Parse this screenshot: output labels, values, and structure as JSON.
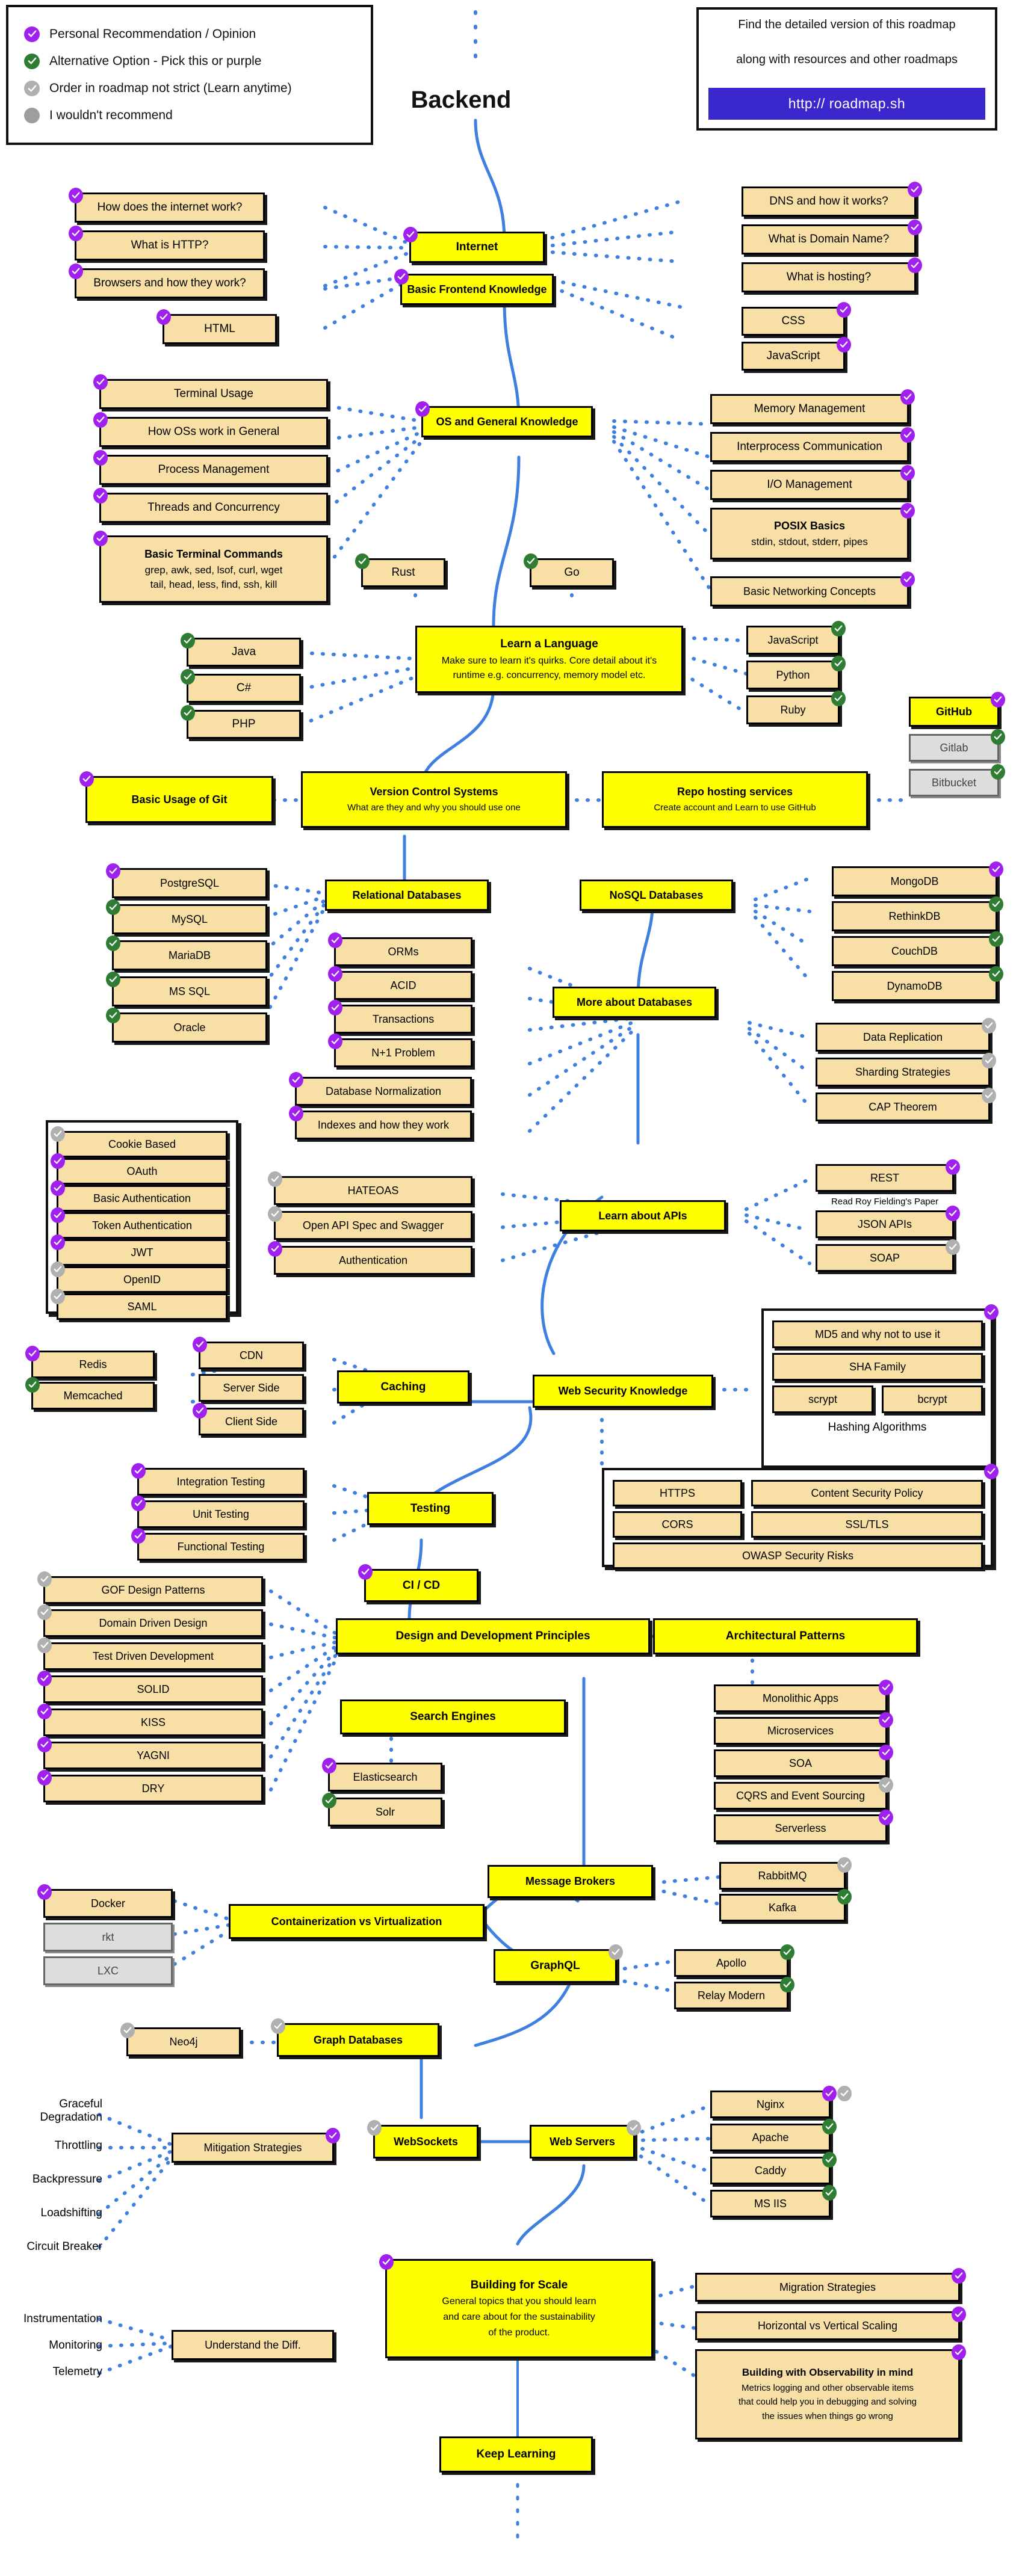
{
  "page_title": "Backend",
  "legend": {
    "items": [
      {
        "icon": "check-circle-icon",
        "color": "#A020F0",
        "label": "Personal Recommendation / Opinion"
      },
      {
        "icon": "check-circle-icon",
        "color": "#2E7D32",
        "label": "Alternative Option - Pick this or purple"
      },
      {
        "icon": "check-circle-icon",
        "color": "#B0B0B0",
        "label": "Order in roadmap not strict (Learn anytime)"
      },
      {
        "icon": "filled-circle-icon",
        "color": "#9E9E9E",
        "label": "I wouldn't recommend"
      }
    ]
  },
  "infobox": {
    "line1": "Find the detailed version of this roadmap",
    "line2": "along with resources and other roadmaps",
    "url_label": "http:// roadmap.sh",
    "url_bg": "#3B28CC"
  },
  "colors": {
    "primary_node": "#FFFF00",
    "sub_node": "#F7DFA5",
    "gray_node": "#DDDDDD",
    "link": "#3E7FE0",
    "purple": "#A020F0",
    "green": "#2E7D32",
    "gray_badge": "#B0B0B0"
  },
  "nodes": {
    "internet": "Internet",
    "basic_frontend": "Basic Frontend Knowledge",
    "how_internet": "How does the internet work?",
    "what_http": "What is HTTP?",
    "browsers": "Browsers and how they work?",
    "html": "HTML",
    "dns": "DNS and how it works?",
    "domain_name": "What is Domain Name?",
    "hosting": "What is hosting?",
    "css": "CSS",
    "javascript_front": "JavaScript",
    "os_general": "OS and General Knowledge",
    "terminal_usage": "Terminal Usage",
    "how_os_work": "How OSs work in General",
    "process_mgmt": "Process Management",
    "threads": "Threads and Concurrency",
    "basic_terminal_title": "Basic Terminal Commands",
    "basic_terminal_line1": "grep, awk, sed, lsof, curl, wget",
    "basic_terminal_line2": "tail, head, less, find, ssh, kill",
    "memory_mgmt": "Memory Management",
    "ipc": "Interprocess Communication",
    "io_mgmt": "I/O Management",
    "posix_title": "POSIX Basics",
    "posix_desc": "stdin, stdout, stderr, pipes",
    "basic_networking": "Basic Networking Concepts",
    "learn_language_title": "Learn a Language",
    "learn_language_desc1": "Make sure to learn it's quirks. Core detail about it's",
    "learn_language_desc2": "runtime e.g. concurrency, memory model etc.",
    "rust": "Rust",
    "go": "Go",
    "java": "Java",
    "csharp": "C#",
    "php": "PHP",
    "javascript_lang": "JavaScript",
    "python": "Python",
    "ruby": "Ruby",
    "vcs_title": "Version Control Systems",
    "vcs_desc": "What are they and why you should use one",
    "repo_title": "Repo hosting services",
    "repo_desc": "Create account and Learn to use GitHub",
    "basic_git": "Basic Usage of Git",
    "github": "GitHub",
    "gitlab": "Gitlab",
    "bitbucket": "Bitbucket",
    "relational_db": "Relational Databases",
    "postgresql": "PostgreSQL",
    "mysql": "MySQL",
    "mariadb": "MariaDB",
    "mssql": "MS SQL",
    "oracle": "Oracle",
    "nosql_db": "NoSQL Databases",
    "mongodb": "MongoDB",
    "rethinkdb": "RethinkDB",
    "couchdb": "CouchDB",
    "dynamodb": "DynamoDB",
    "more_about_db": "More about Databases",
    "orms": "ORMs",
    "acid": "ACID",
    "transactions": "Transactions",
    "n1_problem": "N+1 Problem",
    "db_normalization": "Database Normalization",
    "indexes": "Indexes and how they work",
    "data_replication": "Data Replication",
    "sharding": "Sharding Strategies",
    "cap_theorem": "CAP Theorem",
    "learn_apis": "Learn about APIs",
    "hateoas": "HATEOAS",
    "openapi": "Open API Spec and Swagger",
    "authentication": "Authentication",
    "rest": "REST",
    "rest_note": "Read Roy Fielding's Paper",
    "json_apis": "JSON APIs",
    "soap": "SOAP",
    "cookie_based": "Cookie Based",
    "oauth": "OAuth",
    "basic_auth": "Basic Authentication",
    "token_auth": "Token Authentication",
    "jwt": "JWT",
    "openid": "OpenID",
    "saml": "SAML",
    "caching": "Caching",
    "cdn": "CDN",
    "server_side": "Server Side",
    "client_side": "Client Side",
    "redis": "Redis",
    "memcached": "Memcached",
    "web_security": "Web Security Knowledge",
    "md5": "MD5 and why not to use it",
    "sha": "SHA Family",
    "scrypt": "scrypt",
    "bcrypt": "bcrypt",
    "hashing_label": "Hashing Algorithms",
    "https": "HTTPS",
    "csp": "Content Security Policy",
    "cors": "CORS",
    "ssl_tls": "SSL/TLS",
    "owasp": "OWASP Security Risks",
    "testing": "Testing",
    "integration_testing": "Integration Testing",
    "unit_testing": "Unit Testing",
    "functional_testing": "Functional Testing",
    "ci_cd": "CI / CD",
    "design_principles": "Design and Development Principles",
    "gof": "GOF Design Patterns",
    "ddd": "Domain Driven Design",
    "tdd": "Test Driven Development",
    "solid": "SOLID",
    "kiss": "KISS",
    "yagni": "YAGNI",
    "dry": "DRY",
    "architectural_patterns": "Architectural Patterns",
    "monolithic": "Monolithic Apps",
    "microservices": "Microservices",
    "soa": "SOA",
    "cqrs": "CQRS and Event Sourcing",
    "serverless": "Serverless",
    "search_engines": "Search Engines",
    "elasticsearch": "Elasticsearch",
    "solr": "Solr",
    "message_brokers": "Message Brokers",
    "rabbitmq": "RabbitMQ",
    "kafka": "Kafka",
    "containerization": "Containerization vs Virtualization",
    "docker": "Docker",
    "rkt": "rkt",
    "lxc": "LXC",
    "graphql": "GraphQL",
    "apollo": "Apollo",
    "relay_modern": "Relay Modern",
    "graph_databases": "Graph Databases",
    "neo4j": "Neo4j",
    "websockets": "WebSockets",
    "web_servers": "Web Servers",
    "nginx": "Nginx",
    "apache": "Apache",
    "caddy": "Caddy",
    "ms_iis": "MS IIS",
    "mitigation": "Mitigation Strategies",
    "graceful_degradation": "Graceful\nDegradation",
    "throttling": "Throttling",
    "backpressure": "Backpressure",
    "loadshifting": "Loadshifting",
    "circuit_breaker": "Circuit Breaker",
    "instrumentation": "Instrumentation",
    "monitoring": "Monitoring",
    "telemetry": "Telemetry",
    "understand_diff": "Understand the Diff.",
    "building_scale_title": "Building for Scale",
    "building_scale_desc1": "General topics that you should learn",
    "building_scale_desc2": "and care about for the sustainability",
    "building_scale_desc3": "of the product.",
    "migration_strategies": "Migration Strategies",
    "horizontal_vertical": "Horizontal vs Vertical Scaling",
    "observability_title": "Building with Observability in mind",
    "observability_desc1": "Metrics logging and other observable items",
    "observability_desc2": "that could help you in debugging and solving",
    "observability_desc3": "the issues when things go wrong",
    "keep_learning": "Keep Learning"
  }
}
